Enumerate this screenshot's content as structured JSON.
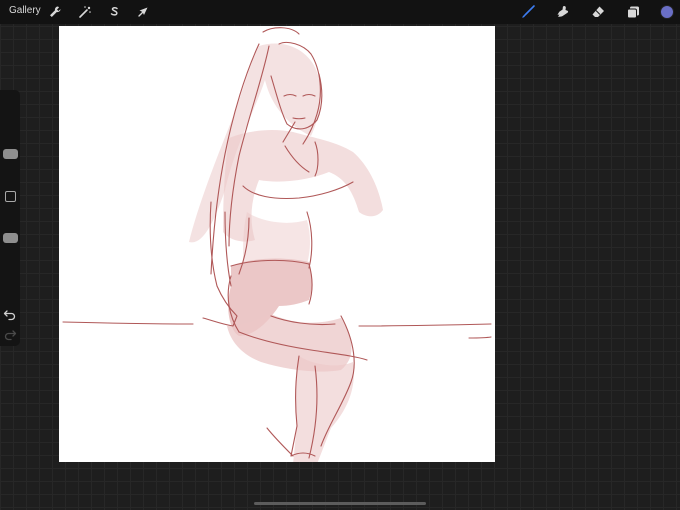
{
  "topbar": {
    "gallery_label": "Gallery",
    "left_tools": [
      {
        "icon": "wrench-icon",
        "name": "actions"
      },
      {
        "icon": "magic-wand-icon",
        "name": "adjustments"
      },
      {
        "icon": "selection-s-icon",
        "name": "selection"
      },
      {
        "icon": "arrow-cursor-icon",
        "name": "transform"
      }
    ],
    "right_tools": [
      {
        "icon": "brush-icon",
        "name": "paint",
        "active": true
      },
      {
        "icon": "smudge-icon",
        "name": "smudge"
      },
      {
        "icon": "eraser-icon",
        "name": "erase"
      },
      {
        "icon": "layers-icon",
        "name": "layers"
      }
    ],
    "active_color": "#6a6fc6"
  },
  "sidebar": {
    "brush_size_level": 0.3,
    "opacity_level": 0.7
  },
  "canvas": {
    "background": "#ffffff",
    "sketch_color": "#b05858"
  }
}
